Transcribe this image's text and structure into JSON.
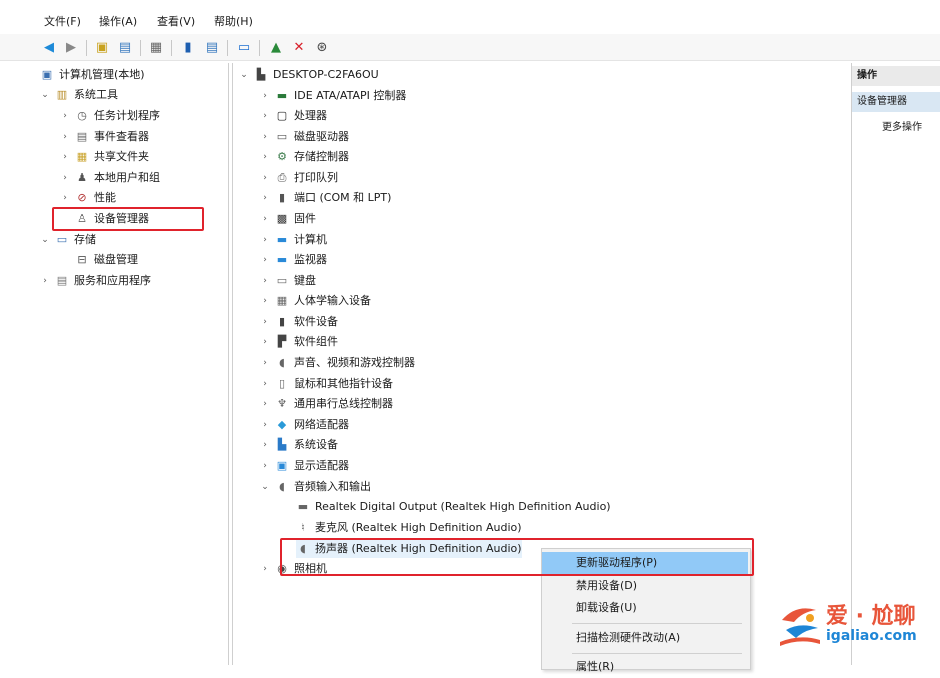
{
  "menu": [
    "文件(F)",
    "操作(A)",
    "查看(V)",
    "帮助(H)"
  ],
  "left_tree": {
    "root": "计算机管理(本地)",
    "system_tools": "系统工具",
    "items": [
      "任务计划程序",
      "事件查看器",
      "共享文件夹",
      "本地用户和组",
      "性能",
      "设备管理器"
    ],
    "storage": "存储",
    "disk_mgmt": "磁盘管理",
    "services": "服务和应用程序"
  },
  "device_tree": {
    "computer": "DESKTOP-C2FA6OU",
    "categories": [
      "IDE ATA/ATAPI 控制器",
      "处理器",
      "磁盘驱动器",
      "存储控制器",
      "打印队列",
      "端口 (COM 和 LPT)",
      "固件",
      "计算机",
      "监视器",
      "键盘",
      "人体学输入设备",
      "软件设备",
      "软件组件",
      "声音、视频和游戏控制器",
      "鼠标和其他指针设备",
      "通用串行总线控制器",
      "网络适配器",
      "系统设备",
      "显示适配器"
    ],
    "audio_io": "音频输入和输出",
    "audio_children": [
      "Realtek Digital Output (Realtek High Definition Audio)",
      "麦克风 (Realtek High Definition Audio)",
      "扬声器 (Realtek High Definition Audio)"
    ],
    "camera": "照相机"
  },
  "actions": {
    "header": "操作",
    "selected": "设备管理器",
    "more": "更多操作"
  },
  "context_menu": [
    "更新驱动程序(P)",
    "禁用设备(D)",
    "卸载设备(U)",
    "扫描检测硬件改动(A)",
    "属性(R)"
  ],
  "watermark": {
    "cn": "爱 · 尬聊",
    "url": "igaliao.com"
  },
  "colors": {
    "highlight": "#91c9f7",
    "red_box": "#e0232c",
    "watermark_orange": "#e8553a",
    "watermark_blue": "#1e86d6"
  }
}
